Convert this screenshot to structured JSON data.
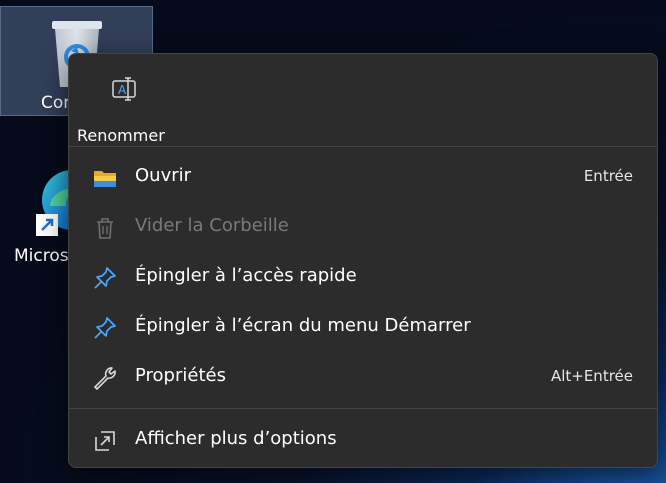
{
  "desktop": {
    "recycle_bin_label": "Cor",
    "edge_label": "Micros"
  },
  "context_menu": {
    "quick_actions": [
      {
        "label": "Renommer",
        "icon": "rename-icon"
      }
    ],
    "items": [
      {
        "label": "Ouvrir",
        "shortcut": "Entrée",
        "icon": "folder-icon",
        "enabled": true
      },
      {
        "label": "Vider la Corbeille",
        "shortcut": "",
        "icon": "trash-icon",
        "enabled": false
      },
      {
        "label": "Épingler à l’accès rapide",
        "shortcut": "",
        "icon": "pin-icon",
        "enabled": true
      },
      {
        "label": "Épingler à l’écran du menu Démarrer",
        "shortcut": "",
        "icon": "pin-icon",
        "enabled": true
      },
      {
        "label": "Propriétés",
        "shortcut": "Alt+Entrée",
        "icon": "wrench-icon",
        "enabled": true
      }
    ],
    "more_options": {
      "label": "Afficher plus d’options",
      "icon": "more-options-icon"
    }
  },
  "colors": {
    "menu_bg": "#2c2c2c",
    "accent_blue": "#4aa8ff",
    "folder_yellow": "#f4c542"
  }
}
